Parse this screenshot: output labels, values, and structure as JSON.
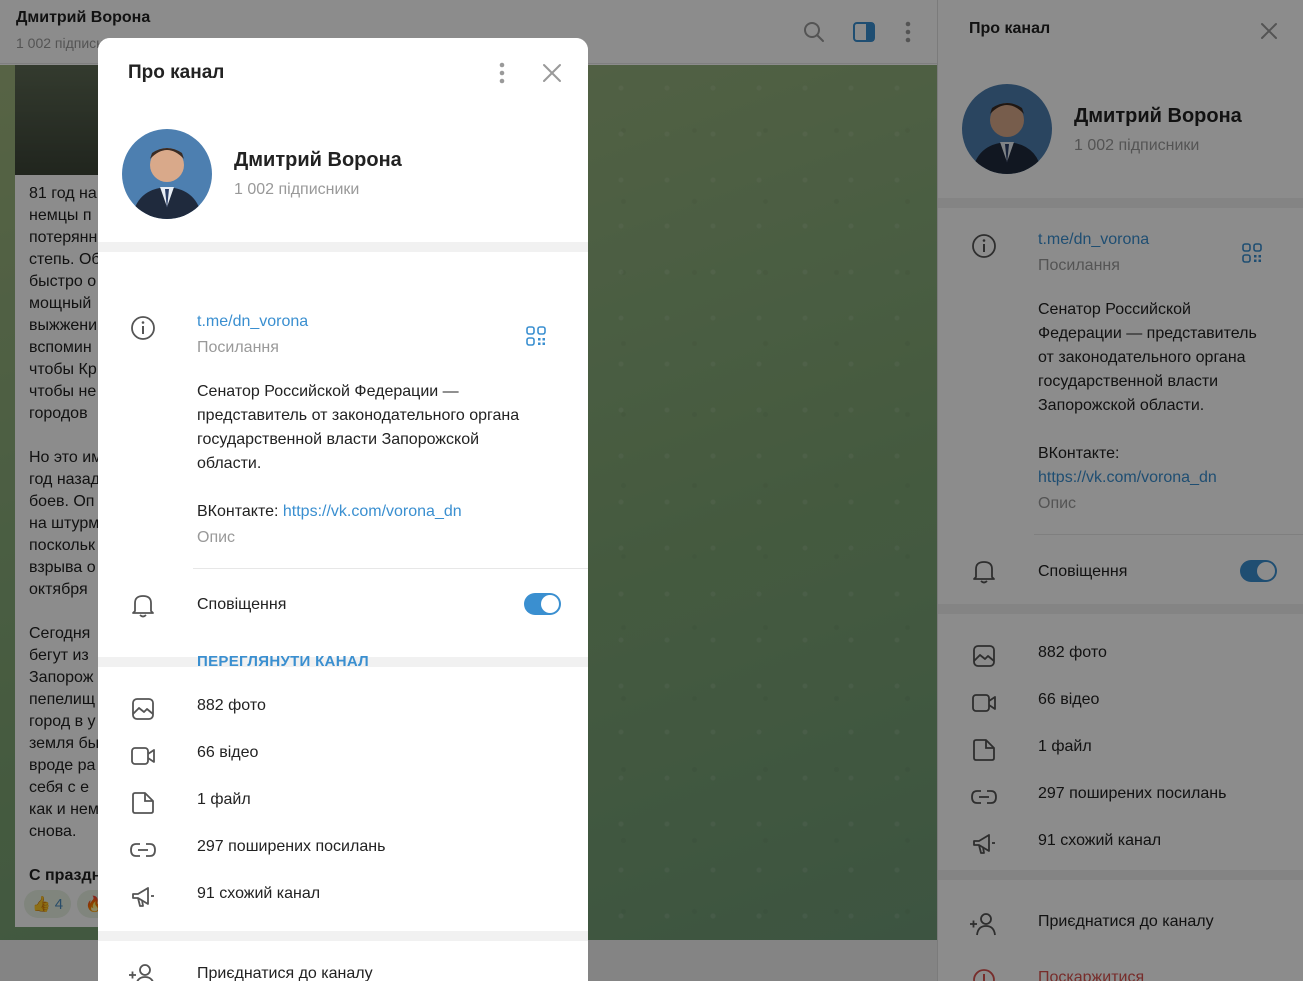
{
  "chat": {
    "title": "Дмитрий Ворона",
    "subscribers": "1 002 підписники",
    "message_lines_1": [
      "81 год на",
      "немцы п",
      "потерянн",
      "степь. Об",
      "быстро о",
      "мощный",
      "выжжени",
      "вспомин",
      "чтобы Кр",
      "чтобы не",
      "городов"
    ],
    "message_lines_2": [
      "Но это им",
      "год назад",
      "боев. Оп",
      "на штурм",
      "поскольк",
      "взрыва о",
      "октября"
    ],
    "message_lines_3": [
      "Сегодня",
      "бегут из",
      "Запорож",
      "пепелищ",
      "город в у",
      "земля бы",
      "вроде ра",
      "себя с е",
      "как и нем",
      "снова."
    ],
    "message_lines_4": [
      "С праздн"
    ],
    "reactions": [
      {
        "emoji": "👍",
        "count": "4"
      },
      {
        "emoji": "🔥",
        "count": ""
      }
    ]
  },
  "modal": {
    "title": "Про канал",
    "channel_name": "Дмитрий Ворона",
    "subscribers": "1 002 підписники",
    "link": "t.me/dn_vorona",
    "link_caption": "Посилання",
    "description_1": "Сенатор Российской Федерации —",
    "description_2": "представитель от законодательного органа",
    "description_3": "государственной власти Запорожской",
    "description_4": "области.",
    "vk_prefix": "ВКонтакте: ",
    "vk_link": "https://vk.com/vorona_dn",
    "description_caption": "Опис",
    "notifications_label": "Сповіщення",
    "notifications_on": true,
    "view_channel": "ПЕРЕГЛЯНУТИ КАНАЛ",
    "media": [
      {
        "icon": "photo-icon",
        "label": "882 фото"
      },
      {
        "icon": "video-icon",
        "label": "66 відео"
      },
      {
        "icon": "file-icon",
        "label": "1 файл"
      },
      {
        "icon": "link-icon",
        "label": "297 поширених посилань"
      },
      {
        "icon": "megaphone-icon",
        "label": "91 схожий канал"
      }
    ],
    "join_label": "Приєднатися до каналу"
  },
  "right_panel": {
    "title": "Про канал",
    "channel_name": "Дмитрий Ворона",
    "subscribers": "1 002 підписники",
    "link": "t.me/dn_vorona",
    "link_caption": "Посилання",
    "description_lines": [
      "Сенатор Российской",
      "Федерации — представитель",
      "от законодательного органа",
      "государственной власти",
      "Запорожской области."
    ],
    "vk_prefix": "ВКонтакте:",
    "vk_link": "https://vk.com/vorona_dn",
    "description_caption": "Опис",
    "notifications_label": "Сповіщення",
    "media": [
      {
        "icon": "photo-icon",
        "label": "882 фото"
      },
      {
        "icon": "video-icon",
        "label": "66 відео"
      },
      {
        "icon": "file-icon",
        "label": "1 файл"
      },
      {
        "icon": "link-icon",
        "label": "297 поширених посилань"
      },
      {
        "icon": "megaphone-icon",
        "label": "91 схожий канал"
      }
    ],
    "join_label": "Приєднатися до каналу",
    "report_label": "Поскаржитися"
  },
  "colors": {
    "accent": "#3a8fd0",
    "danger": "#d9534f",
    "muted": "#999999"
  }
}
